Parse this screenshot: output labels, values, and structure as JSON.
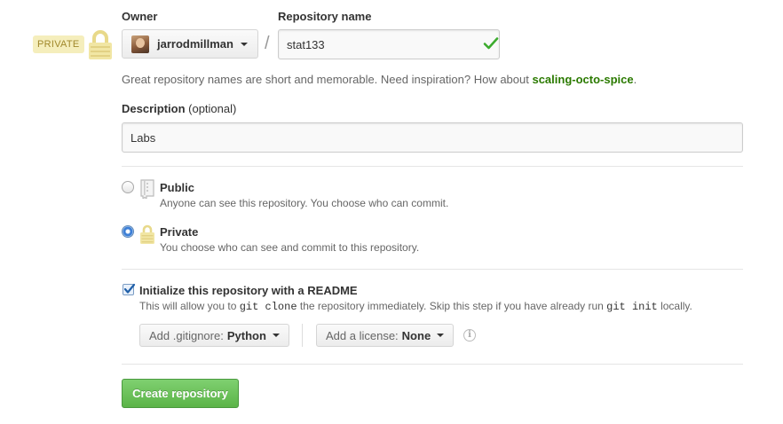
{
  "visibility_badge": "PRIVATE",
  "owner": {
    "label": "Owner",
    "name": "jarrodmillman"
  },
  "repository": {
    "label": "Repository name",
    "value": "stat133",
    "valid": true
  },
  "hint": {
    "text": "Great repository names are short and memorable. Need inspiration? How about ",
    "suggestion": "scaling-octo-spice",
    "end": "."
  },
  "description": {
    "label": "Description",
    "optional": "(optional)",
    "value": "Labs"
  },
  "visibility": {
    "public": {
      "title": "Public",
      "desc": "Anyone can see this repository. You choose who can commit.",
      "checked": false
    },
    "private": {
      "title": "Private",
      "desc": "You choose who can see and commit to this repository.",
      "checked": true
    }
  },
  "readme": {
    "label": "Initialize this repository with a README",
    "checked": true,
    "desc_1": "This will allow you to ",
    "code_1": "git clone",
    "desc_2": " the repository immediately. Skip this step if you have already run ",
    "code_2": "git init",
    "desc_3": " locally."
  },
  "gitignore": {
    "label": "Add .gitignore:",
    "value": "Python"
  },
  "license": {
    "label": "Add a license:",
    "value": "None"
  },
  "info_glyph": "i",
  "create_button": "Create repository",
  "colors": {
    "accent_green": "#5bb448",
    "suggestion_green": "#2b7a00",
    "badge_bg": "#f5eebc",
    "badge_text": "#a1882b"
  },
  "icons": [
    "lock-icon",
    "check-icon",
    "repo-icon",
    "caret-down-icon",
    "info-icon"
  ]
}
